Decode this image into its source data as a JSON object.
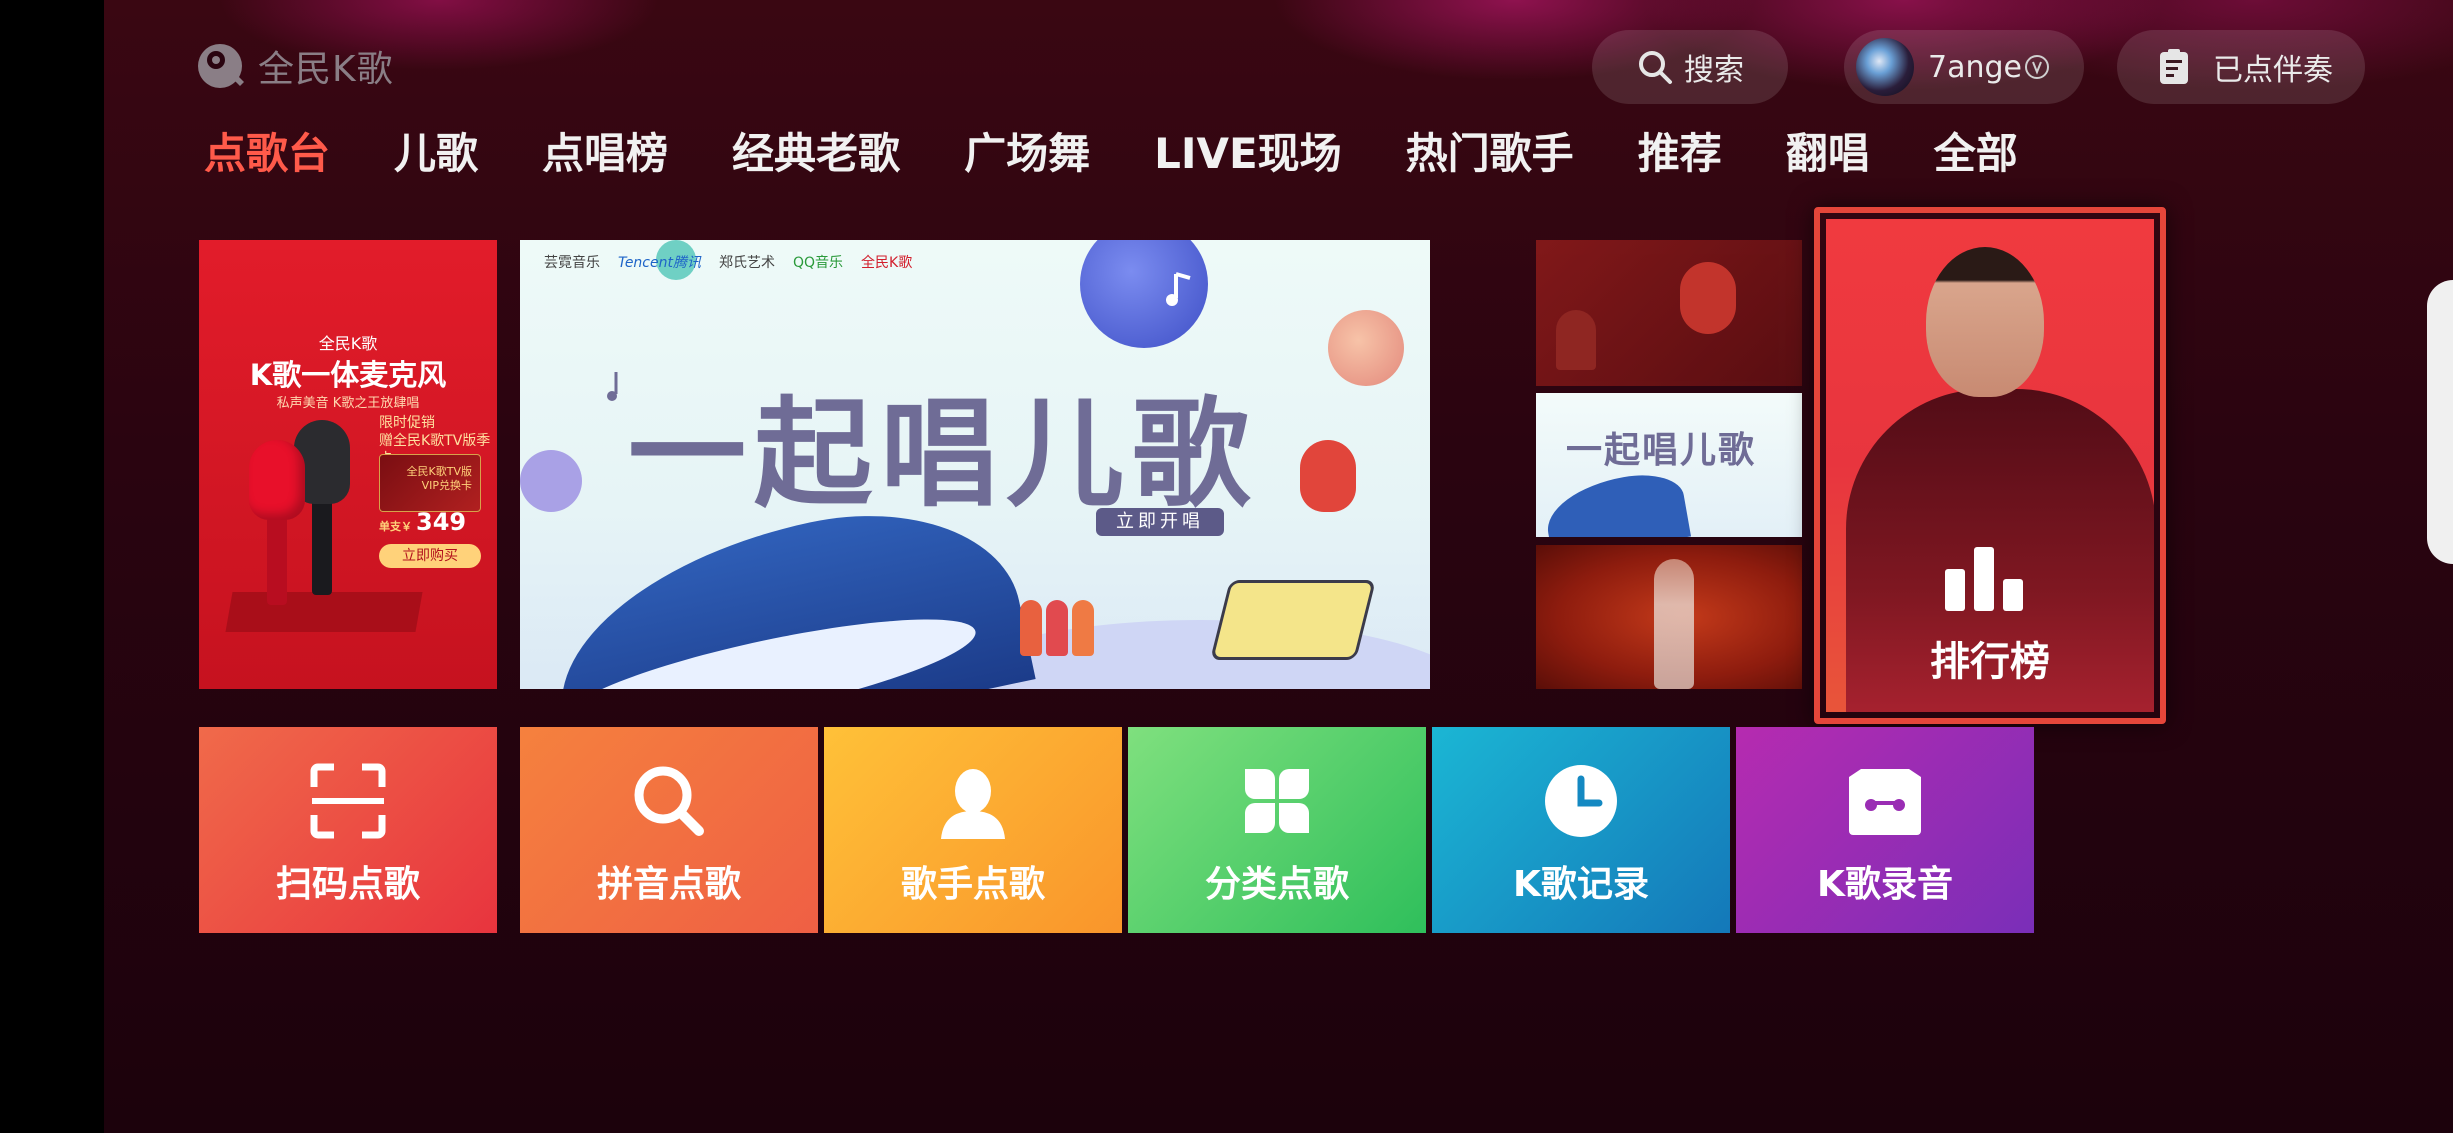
{
  "app": {
    "logo_text": "全民K歌"
  },
  "header": {
    "search_label": "搜索",
    "user_name": "7ange",
    "queue_label": "已点伴奏"
  },
  "tabs": [
    {
      "label": "点歌台",
      "active": true
    },
    {
      "label": "儿歌"
    },
    {
      "label": "点唱榜"
    },
    {
      "label": "经典老歌"
    },
    {
      "label": "广场舞"
    },
    {
      "label": "LIVE现场"
    },
    {
      "label": "热门歌手"
    },
    {
      "label": "推荐"
    },
    {
      "label": "翻唱"
    },
    {
      "label": "全部"
    }
  ],
  "promo": {
    "brand": "全民K歌",
    "headline": "K歌一体麦克风",
    "sub": "私声美音 K歌之王放肆唱",
    "deal_line1": "限时促销",
    "deal_line2": "赠全民K歌TV版季卡",
    "card_text1": "全民K歌TV版",
    "card_text2": "VIP兑换卡",
    "price_prefix": "单支￥",
    "price": "349",
    "buy_label": "立即购买"
  },
  "hero": {
    "sponsors": [
      "芸霓音乐",
      "Tencent腾讯",
      "郑氏艺术",
      "QQ音乐",
      "全民K歌"
    ],
    "title": "一起唱儿歌",
    "cta": "立即开唱"
  },
  "mini2_title": "一起唱儿歌",
  "ranking": {
    "label": "排行榜"
  },
  "tiles": [
    {
      "label": "扫码点歌",
      "icon": "scan-icon"
    },
    {
      "label": "拼音点歌",
      "icon": "search-icon"
    },
    {
      "label": "歌手点歌",
      "icon": "singer-icon"
    },
    {
      "label": "分类点歌",
      "icon": "category-icon"
    },
    {
      "label": "K歌记录",
      "icon": "clock-icon"
    },
    {
      "label": "K歌录音",
      "icon": "recording-icon"
    }
  ],
  "colors": {
    "active_tab": "#ff5a4a",
    "focus_border": "#e5463a",
    "background": "#2a0410"
  }
}
